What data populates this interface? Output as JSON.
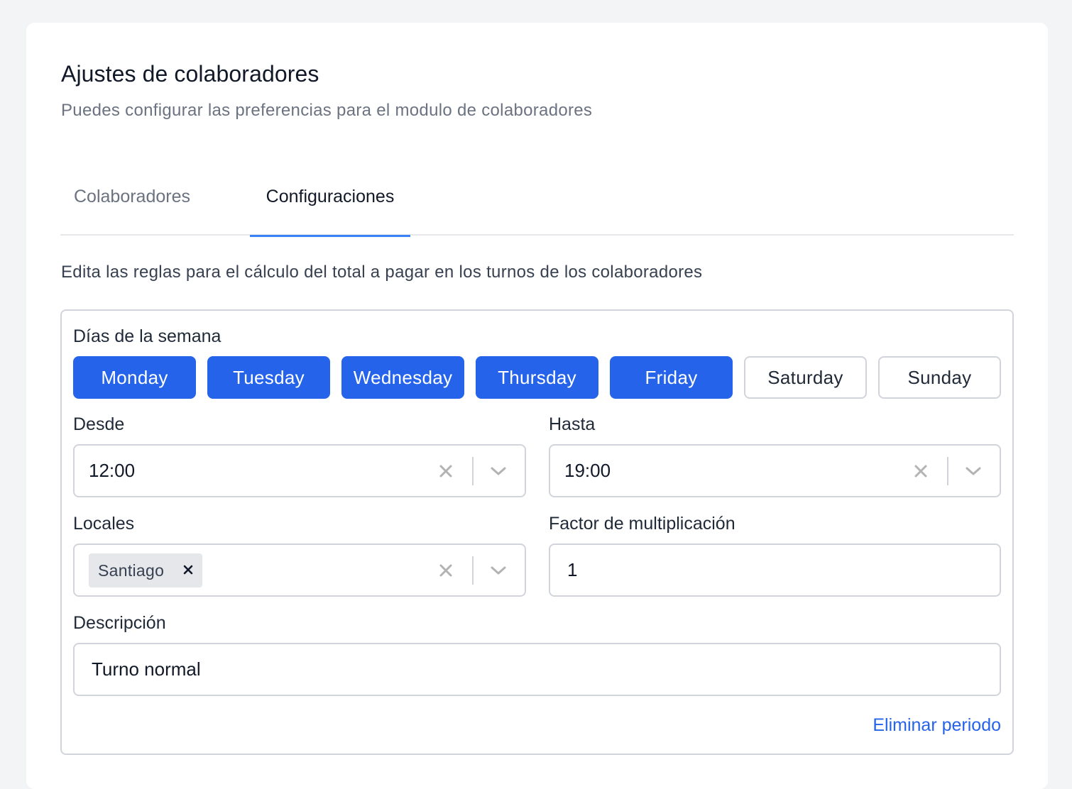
{
  "header": {
    "title": "Ajustes de colaboradores",
    "subtitle": "Puedes configurar las preferencias para el modulo de colaboradores"
  },
  "tabs": [
    {
      "label": "Colaboradores",
      "active": false
    },
    {
      "label": "Configuraciones",
      "active": true
    }
  ],
  "rules_description": "Edita las reglas para el cálculo del total a pagar en los turnos de los colaboradores",
  "period": {
    "days_label": "Días de la semana",
    "days": [
      {
        "label": "Monday",
        "selected": true
      },
      {
        "label": "Tuesday",
        "selected": true
      },
      {
        "label": "Wednesday",
        "selected": true
      },
      {
        "label": "Thursday",
        "selected": true
      },
      {
        "label": "Friday",
        "selected": true
      },
      {
        "label": "Saturday",
        "selected": false
      },
      {
        "label": "Sunday",
        "selected": false
      }
    ],
    "from_label": "Desde",
    "from_value": "12:00",
    "to_label": "Hasta",
    "to_value": "19:00",
    "locations_label": "Locales",
    "locations": [
      "Santiago"
    ],
    "multiplier_label": "Factor de multiplicación",
    "multiplier_value": "1",
    "description_label": "Descripción",
    "description_value": "Turno normal",
    "delete_label": "Eliminar periodo"
  },
  "colors": {
    "accent": "#2563eb",
    "tab_underline": "#3b82f6",
    "border": "#d1d5db",
    "muted_text": "#6b7280"
  },
  "icons": {
    "clear": "close-icon",
    "dropdown": "chevron-down-icon",
    "chip_remove": "close-icon"
  }
}
